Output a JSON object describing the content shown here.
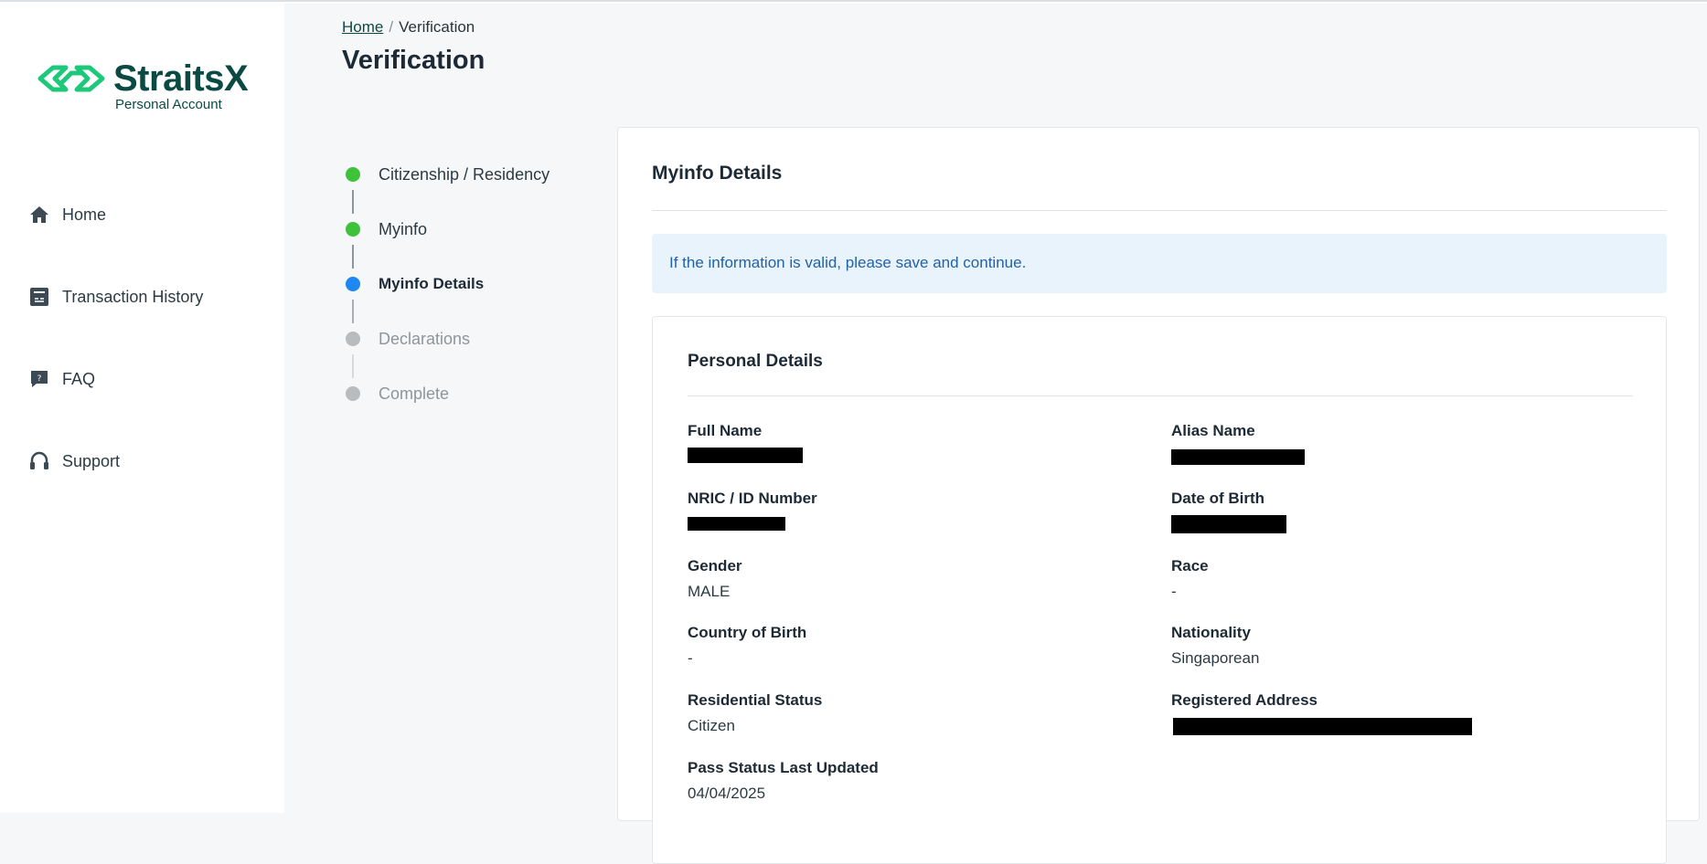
{
  "brand": {
    "name": "StraitsX",
    "subtitle": "Personal Account",
    "accent": "#1ec87a",
    "dark": "#0a4a43"
  },
  "nav": [
    {
      "label": "Home",
      "icon": "home-icon"
    },
    {
      "label": "Transaction History",
      "icon": "receipt-icon"
    },
    {
      "label": "FAQ",
      "icon": "faq-icon"
    },
    {
      "label": "Support",
      "icon": "headset-icon"
    }
  ],
  "breadcrumb": {
    "home": "Home",
    "separator": "/",
    "current": "Verification"
  },
  "page_title": "Verification",
  "steps": [
    {
      "label": "Citizenship / Residency",
      "status": "done",
      "color": "#3dc23a"
    },
    {
      "label": "Myinfo",
      "status": "done",
      "color": "#3dc23a"
    },
    {
      "label": "Myinfo Details",
      "status": "active",
      "color": "#1e88f0"
    },
    {
      "label": "Declarations",
      "status": "pending",
      "color": "#b9bcbf"
    },
    {
      "label": "Complete",
      "status": "pending",
      "color": "#b9bcbf"
    }
  ],
  "card": {
    "title": "Myinfo Details",
    "info": "If the information is valid, please save and continue.",
    "section_title": "Personal Details",
    "fields": {
      "full_name": {
        "label": "Full Name",
        "value": ""
      },
      "alias_name": {
        "label": "Alias Name",
        "value": ""
      },
      "nric": {
        "label": "NRIC / ID Number",
        "value": ""
      },
      "dob": {
        "label": "Date of Birth",
        "value": ""
      },
      "gender": {
        "label": "Gender",
        "value": "MALE"
      },
      "race": {
        "label": "Race",
        "value": "-"
      },
      "country_of_birth": {
        "label": "Country of Birth",
        "value": "-"
      },
      "nationality": {
        "label": "Nationality",
        "value": "Singaporean"
      },
      "residential_status": {
        "label": "Residential Status",
        "value": "Citizen"
      },
      "registered_address": {
        "label": "Registered Address",
        "value": ""
      },
      "pass_status_updated": {
        "label": "Pass Status Last Updated",
        "value": "04/04/2025"
      }
    }
  }
}
